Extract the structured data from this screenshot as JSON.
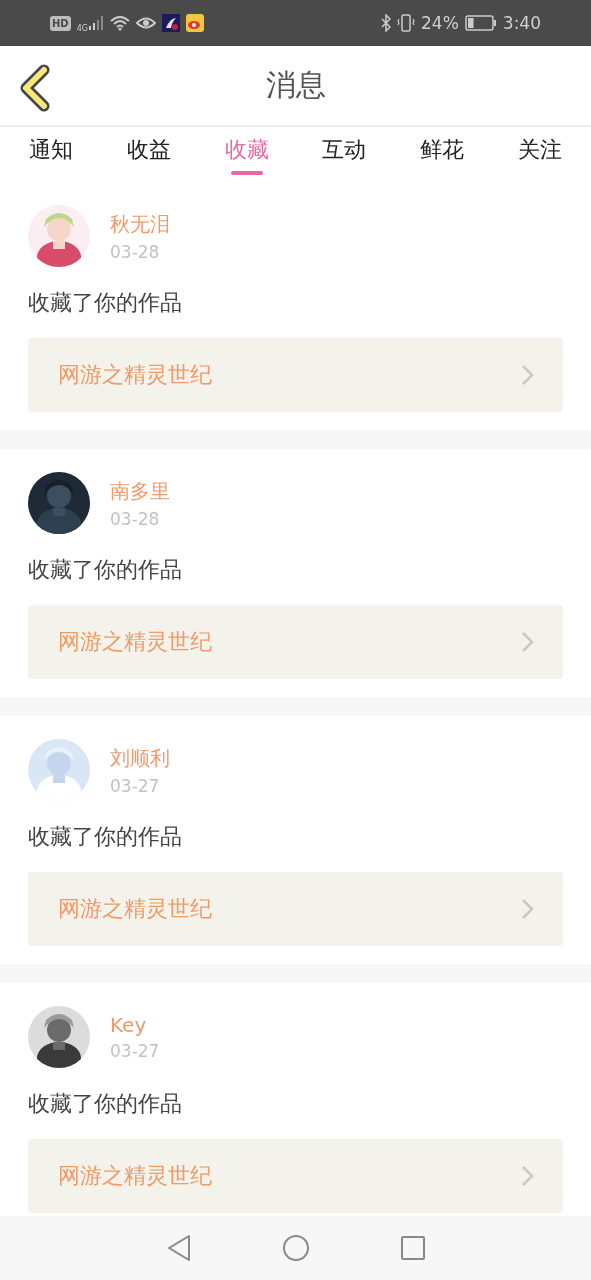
{
  "status_bar": {
    "hd": "HD",
    "network": "4G",
    "battery_percent": "24%",
    "time": "3:40"
  },
  "header": {
    "title": "消息"
  },
  "tabs": [
    {
      "label": "通知",
      "selected": false
    },
    {
      "label": "收益",
      "selected": false
    },
    {
      "label": "收藏",
      "selected": true
    },
    {
      "label": "互动",
      "selected": false
    },
    {
      "label": "鲜花",
      "selected": false
    },
    {
      "label": "关注",
      "selected": false
    }
  ],
  "messages": [
    {
      "user": "秋无泪",
      "date": "03-28",
      "action": "收藏了你的作品",
      "work": "网游之精灵世纪"
    },
    {
      "user": "南多里",
      "date": "03-28",
      "action": "收藏了你的作品",
      "work": "网游之精灵世纪"
    },
    {
      "user": "刘顺利",
      "date": "03-27",
      "action": "收藏了你的作品",
      "work": "网游之精灵世纪"
    },
    {
      "user": "Key",
      "date": "03-27",
      "action": "收藏了你的作品",
      "work": "网游之精灵世纪"
    }
  ]
}
